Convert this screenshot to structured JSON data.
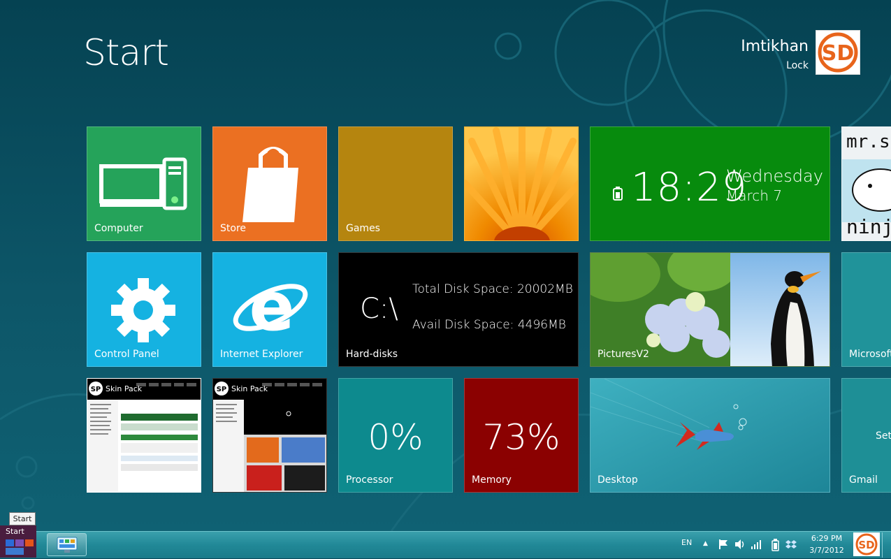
{
  "header": {
    "title": "Start",
    "user_name": "Imtikhan",
    "user_sub": "Lock"
  },
  "tiles": {
    "computer": {
      "label": "Computer",
      "color": "#25a35a"
    },
    "store": {
      "label": "Store",
      "color": "#eb7022"
    },
    "games": {
      "label": "Games",
      "color": "#b5850f"
    },
    "clock": {
      "time": "18:29",
      "day": "Wednesday",
      "date": "March 7",
      "color": "#078b0d"
    },
    "control_panel": {
      "label": "Control Panel",
      "color": "#15b2e1"
    },
    "internet_explorer": {
      "label": "Internet Explorer",
      "color": "#15b2e1"
    },
    "hard_disks": {
      "label": "Hard-disks",
      "drive": "C:\\",
      "total": "Total Disk Space: 20002MB",
      "avail": "Avail Disk Space: 4496MB",
      "color": "#000000"
    },
    "pictures": {
      "label": "PicturesV2"
    },
    "microsoft": {
      "label": "Microsoft"
    },
    "processor": {
      "label": "Processor",
      "value": "0%",
      "color": "#0d8a8e"
    },
    "memory": {
      "label": "Memory",
      "value": "73%",
      "color": "#8b0101"
    },
    "desktop": {
      "label": "Desktop",
      "color": "#2a9aae"
    },
    "gmail": {
      "label": "Gmail",
      "extra": "Set",
      "color": "#1e8f96"
    },
    "skinpack1": {
      "logo_text": "Skin Pack"
    },
    "skinpack2": {
      "logo_text": "Skin Pack"
    },
    "mrs": {
      "text_top": "mr.s",
      "text_bottom": "ninj"
    }
  },
  "taskbar": {
    "start_label": "Start",
    "tooltip": "Start",
    "language": "EN",
    "time": "6:29 PM",
    "date": "3/7/2012"
  }
}
